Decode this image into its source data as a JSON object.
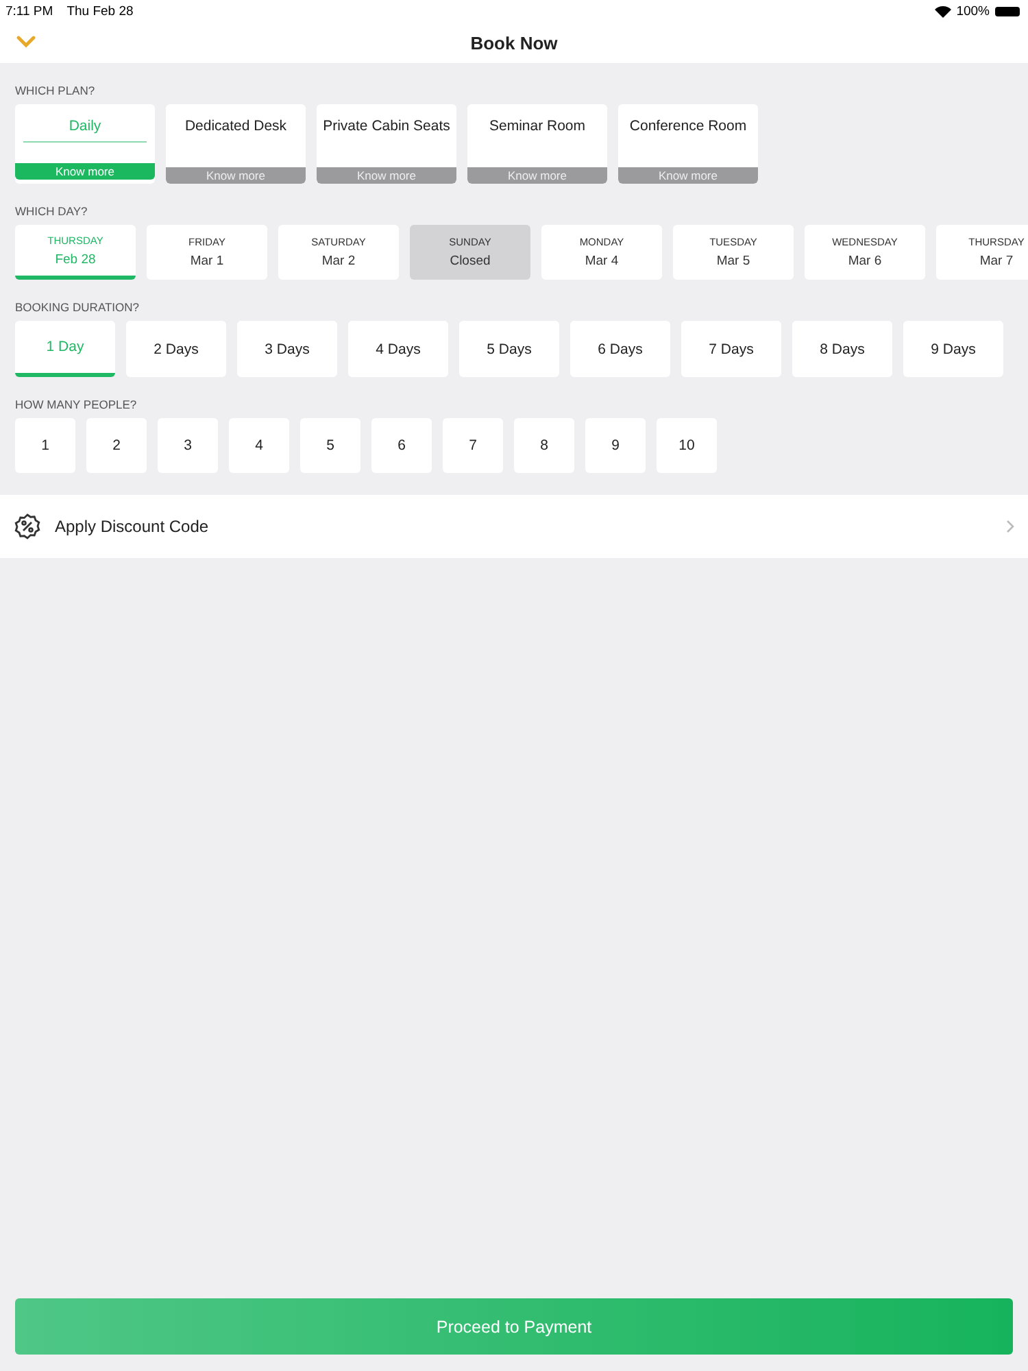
{
  "status_bar": {
    "time": "7:11 PM",
    "date": "Thu Feb 28",
    "battery": "100%"
  },
  "header": {
    "title": "Book Now"
  },
  "plan": {
    "label": "WHICH PLAN?",
    "items": [
      {
        "name": "Daily",
        "link": "Know more",
        "selected": true
      },
      {
        "name": "Dedicated Desk",
        "link": "Know more",
        "selected": false
      },
      {
        "name": "Private Cabin Seats",
        "link": "Know more",
        "selected": false
      },
      {
        "name": "Seminar Room",
        "link": "Know more",
        "selected": false
      },
      {
        "name": "Conference Room",
        "link": "Know more",
        "selected": false
      }
    ]
  },
  "day": {
    "label": "WHICH DAY?",
    "items": [
      {
        "weekday": "THURSDAY",
        "date": "Feb 28",
        "selected": true,
        "disabled": false
      },
      {
        "weekday": "FRIDAY",
        "date": "Mar 1",
        "selected": false,
        "disabled": false
      },
      {
        "weekday": "SATURDAY",
        "date": "Mar 2",
        "selected": false,
        "disabled": false
      },
      {
        "weekday": "SUNDAY",
        "date": "Closed",
        "selected": false,
        "disabled": true
      },
      {
        "weekday": "MONDAY",
        "date": "Mar 4",
        "selected": false,
        "disabled": false
      },
      {
        "weekday": "TUESDAY",
        "date": "Mar 5",
        "selected": false,
        "disabled": false
      },
      {
        "weekday": "WEDNESDAY",
        "date": "Mar 6",
        "selected": false,
        "disabled": false
      },
      {
        "weekday": "THURSDAY",
        "date": "Mar 7",
        "selected": false,
        "disabled": false
      }
    ]
  },
  "duration": {
    "label": "BOOKING DURATION?",
    "items": [
      {
        "text": "1 Day",
        "selected": true
      },
      {
        "text": "2 Days",
        "selected": false
      },
      {
        "text": "3 Days",
        "selected": false
      },
      {
        "text": "4 Days",
        "selected": false
      },
      {
        "text": "5 Days",
        "selected": false
      },
      {
        "text": "6 Days",
        "selected": false
      },
      {
        "text": "7 Days",
        "selected": false
      },
      {
        "text": "8 Days",
        "selected": false
      },
      {
        "text": "9 Days",
        "selected": false
      }
    ]
  },
  "people": {
    "label": "HOW MANY PEOPLE?",
    "items": [
      {
        "text": "1",
        "selected": false
      },
      {
        "text": "2",
        "selected": false
      },
      {
        "text": "3",
        "selected": false
      },
      {
        "text": "4",
        "selected": false
      },
      {
        "text": "5",
        "selected": false
      },
      {
        "text": "6",
        "selected": false
      },
      {
        "text": "7",
        "selected": false
      },
      {
        "text": "8",
        "selected": false
      },
      {
        "text": "9",
        "selected": false
      },
      {
        "text": "10",
        "selected": false
      }
    ]
  },
  "discount": {
    "text": "Apply Discount Code"
  },
  "footer": {
    "button": "Proceed to Payment"
  }
}
